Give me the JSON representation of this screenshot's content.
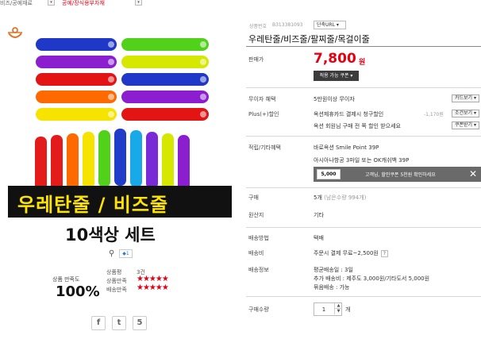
{
  "breadcrumb": {
    "first": "비즈/공예재료",
    "second": "공예/장식용부자재"
  },
  "gallery": {
    "banner_main": "우레탄줄 / 비즈줄",
    "banner_sub": "10색상 세트",
    "spool_colors": [
      "#1f38c8",
      "#8b1fd0",
      "#e31414",
      "#ff6a00",
      "#f6e400",
      "#52d11b",
      "#d6e800",
      "#e41b1b",
      "#1aa9e8",
      "#1f3dc8",
      "#7a2bd8"
    ],
    "zoom_count": "1"
  },
  "satisfaction": {
    "label": "상품 만족도",
    "value": "100%",
    "review_label": "상품평",
    "review_count": "3건",
    "product_label": "상품만족",
    "product_stars": 5,
    "delivery_label": "배송만족",
    "delivery_stars": 5
  },
  "share": {
    "facebook": "f",
    "twitter": "t",
    "other": "5"
  },
  "product": {
    "number_label": "상품번호",
    "number": "B313381093",
    "short_url_label": "단축URL",
    "title": "우레탄줄/비즈줄/팔찌줄/목걸이줄",
    "price_label": "판매가",
    "price": "7,800",
    "price_unit": "원",
    "coupon_button": "적용 가능 쿠폰"
  },
  "benefits": {
    "free_label": "무이자 혜택",
    "free_text": "5만원이상 무이자",
    "card_button": "카드보기",
    "plus_label": "Plus(+)할인",
    "plus_text1": "옥션제휴카드 결제시 청구할인",
    "plus_discount": "-1,170원",
    "condition_button": "조건보기",
    "plus_text2": "옥션 회원님 구매 전 쪽 할인 받으세요",
    "coupon_button": "쿠폰받기"
  },
  "points": {
    "label": "적립/기타혜택",
    "line1": "바로옥션 Smile Point 39P",
    "line2": "아시아나항공 3마일 또는 OK캐쉬백 39P",
    "promo_amount": "5,000",
    "promo_text": "고객님, 할인쿠폰 5천원 확인하세요"
  },
  "purchase": {
    "buy_label": "구매",
    "buy_value": "5개",
    "remaining": "(남은수량 994개)",
    "origin_label": "원산지",
    "origin_value": "기타",
    "ship_method_label": "배송방법",
    "ship_method": "택배",
    "ship_fee_label": "배송비",
    "ship_fee": "주문시 결제 무료~2,500원",
    "ship_info_label": "배송정보",
    "ship_info1": "평균배송일 : 3일",
    "ship_info2": "추가 배송비 : 제주도 3,000원/기타도서 5,000원",
    "ship_info3": "묶음배송 : 가능",
    "qty_label": "구매수량",
    "qty_value": "1",
    "qty_unit": "개"
  }
}
